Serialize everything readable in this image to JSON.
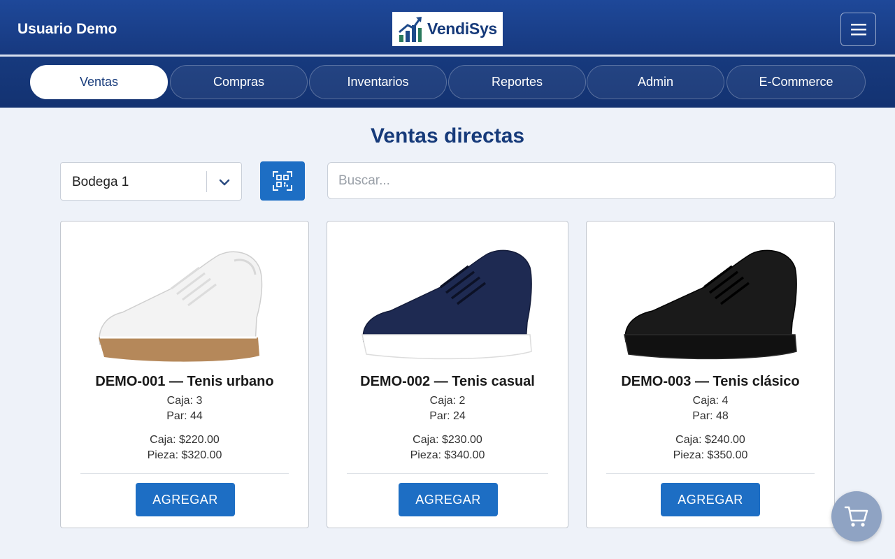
{
  "header": {
    "user_name": "Usuario Demo",
    "brand": "VendiSys",
    "menu_icon": "hamburger-icon"
  },
  "nav": {
    "tabs": [
      {
        "label": "Ventas",
        "active": true
      },
      {
        "label": "Compras",
        "active": false
      },
      {
        "label": "Inventarios",
        "active": false
      },
      {
        "label": "Reportes",
        "active": false
      },
      {
        "label": "Admin",
        "active": false
      },
      {
        "label": "E-Commerce",
        "active": false
      }
    ]
  },
  "main": {
    "title": "Ventas directas",
    "warehouse": {
      "selected": "Bodega 1"
    },
    "scan_icon": "qr-scan-icon",
    "search": {
      "placeholder": "Buscar...",
      "value": ""
    }
  },
  "products": [
    {
      "name": "DEMO-001 — Tenis urbano",
      "caja_stock": "Caja: 3",
      "par_stock": "Par: 44",
      "caja_price": "Caja: $220.00",
      "pieza_price": "Pieza: $320.00",
      "button": "AGREGAR",
      "image": "white-sneaker-icon"
    },
    {
      "name": "DEMO-002 — Tenis casual",
      "caja_stock": "Caja: 2",
      "par_stock": "Par: 24",
      "caja_price": "Caja: $230.00",
      "pieza_price": "Pieza: $340.00",
      "button": "AGREGAR",
      "image": "navy-sneaker-icon"
    },
    {
      "name": "DEMO-003 — Tenis clásico",
      "caja_stock": "Caja: 4",
      "par_stock": "Par: 48",
      "caja_price": "Caja: $240.00",
      "pieza_price": "Pieza: $350.00",
      "button": "AGREGAR",
      "image": "black-sneaker-icon"
    }
  ],
  "cart_icon": "shopping-cart-icon",
  "colors": {
    "header_bg": "#1e4899",
    "accent": "#1d6ec4",
    "title": "#163a7a"
  }
}
